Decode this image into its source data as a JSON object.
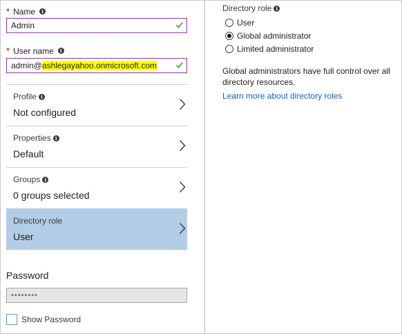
{
  "form": {
    "name": {
      "label": "Name",
      "value": "Admin",
      "required": true
    },
    "user_name": {
      "label": "User name",
      "value_prefix": "admin@",
      "value_highlight": "ashlegayahoo.onmicrosoft.com",
      "required": true
    },
    "rows": [
      {
        "title": "Profile",
        "value": "Not configured"
      },
      {
        "title": "Properties",
        "value": "Default"
      },
      {
        "title": "Groups",
        "value": "0 groups selected"
      },
      {
        "title": "Directory role",
        "value": "User",
        "selected": true
      }
    ],
    "password": {
      "label": "Password",
      "value": "••••••••"
    },
    "show_password_label": "Show Password"
  },
  "directory_role_panel": {
    "title": "Directory role",
    "options": [
      {
        "label": "User",
        "checked": false
      },
      {
        "label": "Global administrator",
        "checked": true
      },
      {
        "label": "Limited administrator",
        "checked": false
      }
    ],
    "description": "Global administrators have full control over all directory resources.",
    "link_text": "Learn more about directory roles"
  },
  "colors": {
    "selected_row_bg": "#b3cde6",
    "input_border": "#8e3aa6",
    "check_green": "#3a9a2a",
    "link": "#1a5fb4",
    "highlight": "#ffff00"
  },
  "icons": {
    "info": "info-icon",
    "check": "checkmark-icon",
    "chevron": "chevron-right-icon"
  }
}
